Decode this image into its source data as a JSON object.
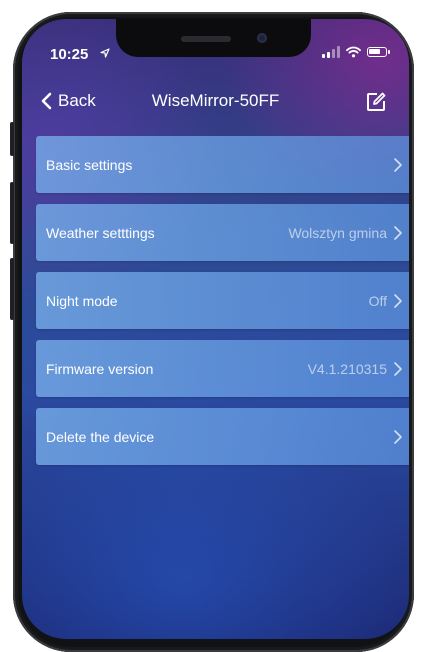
{
  "status_bar": {
    "time": "10:25",
    "location_icon": "location-arrow-icon",
    "icons": [
      "signal-icon",
      "wifi-icon",
      "battery-icon"
    ]
  },
  "nav": {
    "back_label": "Back",
    "title": "WiseMirror-50FF",
    "edit_icon": "edit-icon"
  },
  "settings": [
    {
      "label": "Basic settings",
      "value": ""
    },
    {
      "label": "Weather setttings",
      "value": "Wolsztyn gmina"
    },
    {
      "label": "Night mode",
      "value": "Off"
    },
    {
      "label": "Firmware version",
      "value": "V4.1.210315"
    },
    {
      "label": "Delete the device",
      "value": ""
    }
  ],
  "colors": {
    "row_fill": "#78afeb",
    "text": "#ffffff",
    "value_text": "#c9d8f5"
  }
}
